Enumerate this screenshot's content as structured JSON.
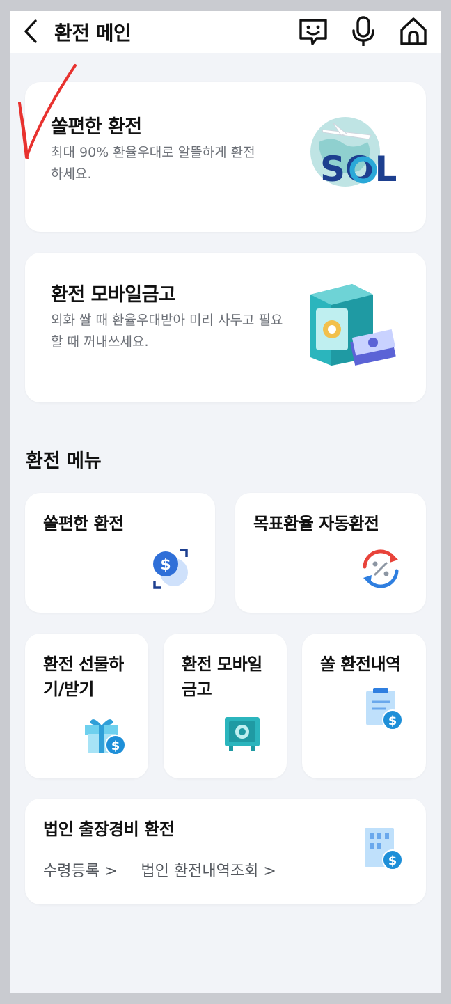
{
  "header": {
    "title": "환전 메인",
    "back_icon": "chevron-left-icon",
    "icons": [
      "chat-bot-icon",
      "microphone-icon",
      "home-icon"
    ]
  },
  "banners": [
    {
      "title": "쏠편한 환전",
      "desc": "최대 90% 환율우대로 알뜰하게 환전하세요.",
      "image_text": "SOL",
      "icon": "globe-airplane-sol-logo"
    },
    {
      "title": "환전 모바일금고",
      "desc": "외화 쌀 때 환율우대받아 미리 사두고 필요할 때 꺼내쓰세요.",
      "icon": "safe-with-money-icon"
    }
  ],
  "section": {
    "title": "환전 메뉴"
  },
  "menu": {
    "easy_exchange": "쏠편한 환전",
    "auto_exchange": "목표환율 자동환전",
    "gift": "환전 선물하기/받기",
    "mobile_safe": "환전 모바일금고",
    "history": "쏠 환전내역",
    "corporate": {
      "title": "법인 출장경비 환전",
      "links": [
        "수령등록",
        "법인 환전내역조회"
      ]
    }
  },
  "colors": {
    "accent_blue": "#2f6fd8",
    "teal": "#2bb5bd",
    "background": "#f2f4f8",
    "annotation_red": "#e8322f"
  }
}
